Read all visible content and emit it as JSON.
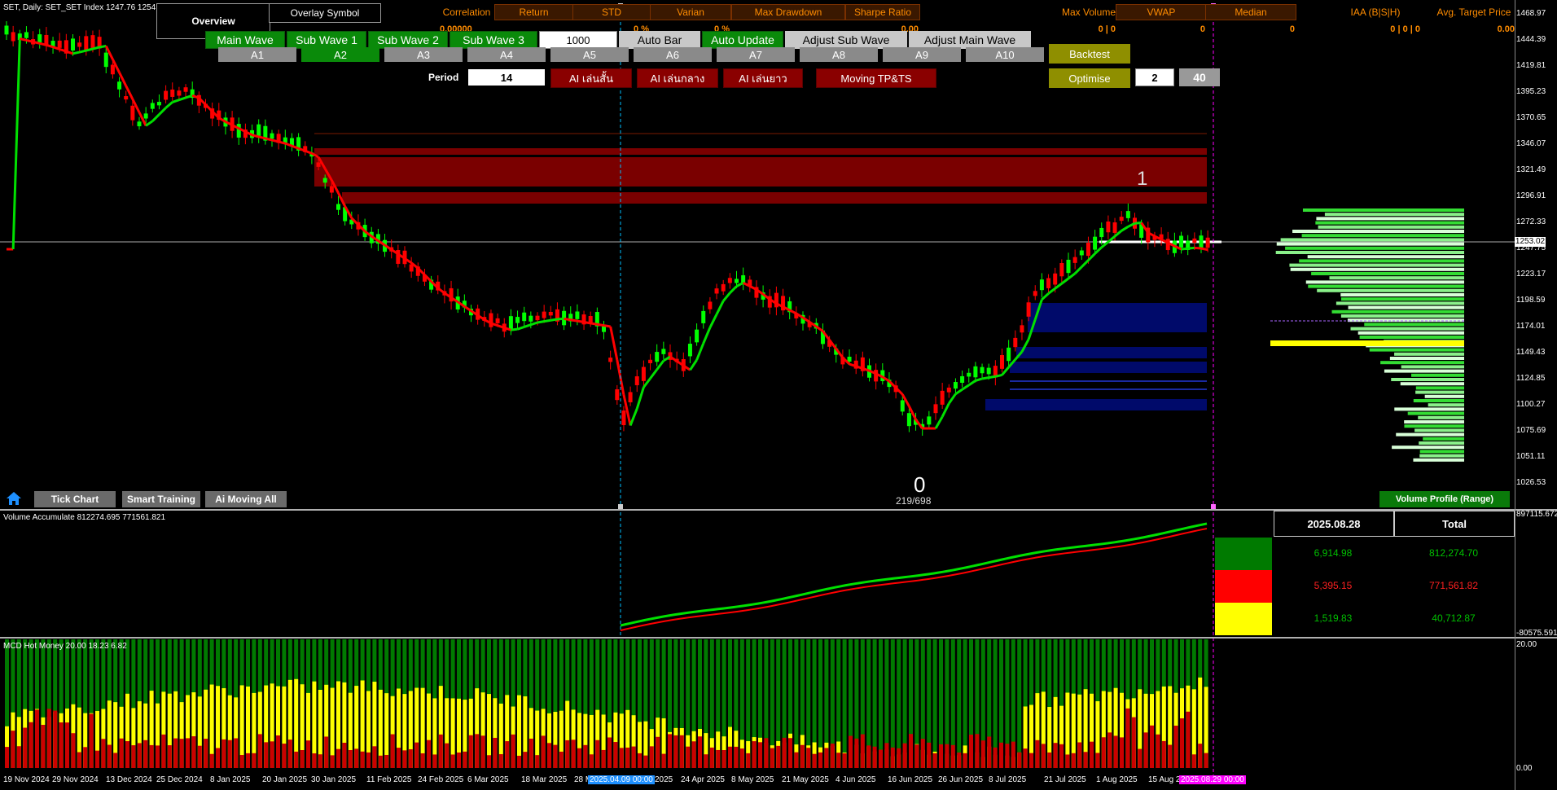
{
  "header": {
    "symbol_line": "SET, Daily:  SET_SET Index  1247.76 1254",
    "tab_overview": "Overview",
    "tab_overlay": "Overlay Symbol"
  },
  "metrics": [
    {
      "label": "Correlation",
      "value": "0.00000"
    },
    {
      "label": "Return",
      "value": ""
    },
    {
      "label": "STD",
      "value": "0 %"
    },
    {
      "label": "Varian",
      "value": "0 %"
    },
    {
      "label": "Max Drawdown",
      "value": ""
    },
    {
      "label": "Sharpe Ratio",
      "value": "0.00"
    },
    {
      "label": "Max Volume",
      "value": "0 | 0"
    },
    {
      "label": "VWAP",
      "value": "0"
    },
    {
      "label": "Median",
      "value": "0"
    },
    {
      "label": "IAA (B|S|H)",
      "value": "0 | 0 | 0"
    },
    {
      "label": "Avg. Target Price",
      "value": "0.00"
    }
  ],
  "wave_buttons": [
    "Main Wave",
    "Sub Wave 1",
    "Sub Wave 2",
    "Sub Wave 3"
  ],
  "input_1000": "1000",
  "auto_bar": "Auto Bar",
  "auto_update": "Auto Update",
  "adjust_sub_wave": "Adjust Sub Wave",
  "adjust_main_wave": "Adjust Main Wave",
  "a_buttons": [
    "A1",
    "A2",
    "A3",
    "A4",
    "A5",
    "A6",
    "A7",
    "A8",
    "A9",
    "A10"
  ],
  "backtest": "Backtest",
  "optimise": "Optimise",
  "opt_val_1": "2",
  "opt_val_2": "40",
  "period_label": "Period",
  "period_value": "14",
  "ai_short": "AI เล่นสั้น",
  "ai_mid": "AI เล่นกลาง",
  "ai_long": "AI เล่นยาว",
  "moving_tpts": "Moving TP&TS",
  "bottom_buttons": {
    "tick": "Tick Chart",
    "smart": "Smart Training",
    "ai_moving": "Ai Moving All"
  },
  "volume_profile_button": "Volume Profile (Range)",
  "wave_labels": {
    "one": "1",
    "zero": "0",
    "count": "219/698"
  },
  "price_axis": [
    "1468.97",
    "1444.39",
    "1419.81",
    "1395.23",
    "1370.65",
    "1346.07",
    "1321.49",
    "1296.91",
    "1272.33",
    "1247.75",
    "1223.17",
    "1198.59",
    "1174.01",
    "1149.43",
    "1124.85",
    "1100.27",
    "1075.69",
    "1051.11",
    "1026.53"
  ],
  "current_price": "1253.02",
  "vol_panel": {
    "title": "Volume Accumulate 812274.695 771561.821",
    "axis_top": "897115.672",
    "axis_bottom": "-80575.591",
    "date_header": "2025.08.28",
    "total_header": "Total",
    "rows": [
      {
        "color": "#007a00",
        "day": "6,914.98",
        "total": "812,274.70",
        "text_color": "#00c000"
      },
      {
        "color": "#ff0000",
        "day": "5,395.15",
        "total": "771,561.82",
        "text_color": "#ff2020"
      },
      {
        "color": "#ffff00",
        "day": "1,519.83",
        "total": "40,712.87",
        "text_color": "#00c000"
      }
    ]
  },
  "hot_panel": {
    "title": "MCD Hot Money 20.00 18.23 6.82",
    "axis_top": "20.00",
    "axis_bottom": "0.00"
  },
  "x_axis": [
    "19 Nov 2024",
    "29 Nov 2024",
    "13 Dec 2024",
    "25 Dec 2024",
    "8 Jan 2025",
    "20 Jan 2025",
    "30 Jan 2025",
    "11 Feb 2025",
    "24 Feb 2025",
    "6 Mar 2025",
    "18 Mar 2025",
    "28 M",
    "2025.04.09 00:00",
    "2025",
    "24 Apr 2025",
    "8 May 2025",
    "21 May 2025",
    "4 Jun 2025",
    "16 Jun 2025",
    "26 Jun 2025",
    "8 Jul 2025",
    "21 Jul 2025",
    "1 Aug 2025",
    "15 Aug 2",
    "2025.08.29 00:00"
  ],
  "colors": {
    "up": "#00ff00",
    "down": "#ff0000",
    "vwap_line_up": "#00e000",
    "vwap_line_down": "#ff0000",
    "zone_red": "#7a0000",
    "zone_blue": "#000a6a",
    "cursor_cyan": "#00bfff",
    "cursor_magenta": "#ff00ff"
  }
}
